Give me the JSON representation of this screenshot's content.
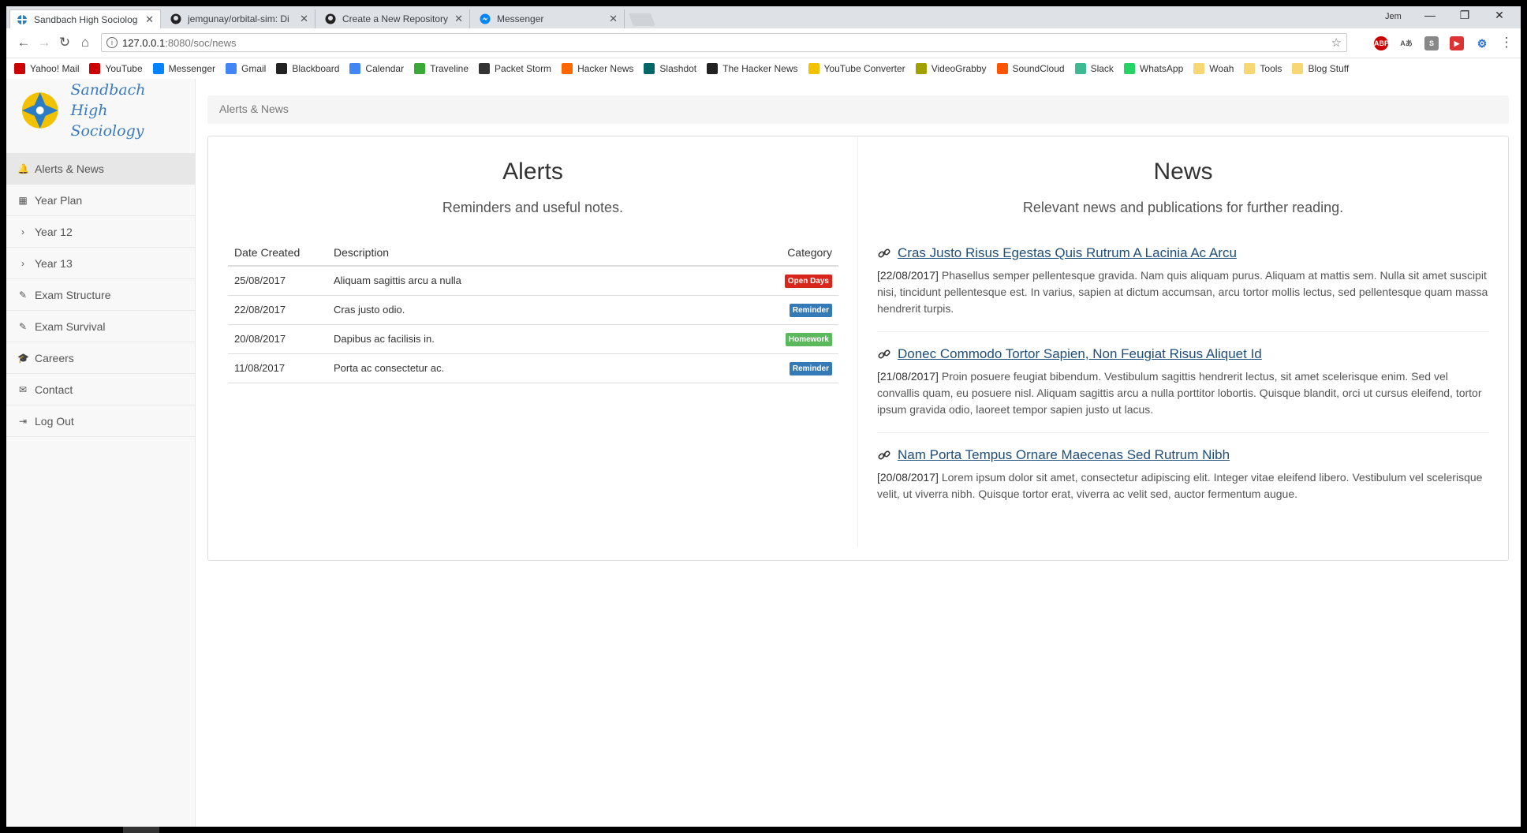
{
  "browser": {
    "tabs": [
      {
        "title": "Sandbach High Sociolog",
        "active": true,
        "icon": "site-logo-icon"
      },
      {
        "title": "jemgunay/orbital-sim: Di",
        "active": false,
        "icon": "github-icon"
      },
      {
        "title": "Create a New Repository",
        "active": false,
        "icon": "github-icon"
      },
      {
        "title": "Messenger",
        "active": false,
        "icon": "messenger-icon"
      }
    ],
    "user": "Jem",
    "url_host": "127.0.0.1",
    "url_path": ":8080/soc/news",
    "bookmarks": [
      {
        "label": "Yahoo! Mail",
        "color": "#cc0000",
        "icon": "youtube-red-icon"
      },
      {
        "label": "YouTube",
        "color": "#cc0000",
        "icon": "youtube-icon"
      },
      {
        "label": "Messenger",
        "color": "#0084ff",
        "icon": "messenger-icon"
      },
      {
        "label": "Gmail",
        "color": "#4285f4",
        "icon": "google-icon"
      },
      {
        "label": "Blackboard",
        "color": "#222222",
        "icon": "blackboard-icon"
      },
      {
        "label": "Calendar",
        "color": "#4285f4",
        "icon": "calendar-icon"
      },
      {
        "label": "Traveline",
        "color": "#3aa935",
        "icon": "traveline-icon"
      },
      {
        "label": "Packet Storm",
        "color": "#333333",
        "icon": "packetstorm-icon"
      },
      {
        "label": "Hacker News",
        "color": "#ff6600",
        "icon": "hackernews-icon"
      },
      {
        "label": "Slashdot",
        "color": "#006666",
        "icon": "slashdot-icon"
      },
      {
        "label": "The Hacker News",
        "color": "#222222",
        "icon": "thehackernews-icon"
      },
      {
        "label": "YouTube Converter",
        "color": "#f2c200",
        "icon": "converter-icon"
      },
      {
        "label": "VideoGrabby",
        "color": "#a0a000",
        "icon": "videograbby-icon"
      },
      {
        "label": "SoundCloud",
        "color": "#ff5500",
        "icon": "soundcloud-icon"
      },
      {
        "label": "Slack",
        "color": "#3eb991",
        "icon": "slack-icon"
      },
      {
        "label": "WhatsApp",
        "color": "#25d366",
        "icon": "whatsapp-icon"
      },
      {
        "label": "Woah",
        "color": "#f7d774",
        "icon": "folder-icon"
      },
      {
        "label": "Tools",
        "color": "#f7d774",
        "icon": "folder-icon"
      },
      {
        "label": "Blog Stuff",
        "color": "#f7d774",
        "icon": "folder-icon"
      }
    ]
  },
  "site": {
    "title_line1": "Sandbach High",
    "title_line2": "Sociology",
    "nav": [
      {
        "label": "Alerts & News",
        "icon": "bell-icon",
        "glyph": "🔔",
        "active": true
      },
      {
        "label": "Year Plan",
        "icon": "calendar-icon",
        "glyph": "▦",
        "active": false
      },
      {
        "label": "Year 12",
        "icon": "chevron-right-icon",
        "glyph": "›",
        "active": false
      },
      {
        "label": "Year 13",
        "icon": "chevron-right-icon",
        "glyph": "›",
        "active": false
      },
      {
        "label": "Exam Structure",
        "icon": "pencil-icon",
        "glyph": "✎",
        "active": false
      },
      {
        "label": "Exam Survival",
        "icon": "pencil-icon",
        "glyph": "✎",
        "active": false
      },
      {
        "label": "Careers",
        "icon": "graduation-cap-icon",
        "glyph": "🎓",
        "active": false
      },
      {
        "label": "Contact",
        "icon": "envelope-icon",
        "glyph": "✉",
        "active": false
      },
      {
        "label": "Log Out",
        "icon": "logout-icon",
        "glyph": "⇥",
        "active": false
      }
    ]
  },
  "breadcrumb": "Alerts & News",
  "alerts": {
    "title": "Alerts",
    "subtitle": "Reminders and useful notes.",
    "columns": [
      "Date Created",
      "Description",
      "Category"
    ],
    "rows": [
      {
        "date": "25/08/2017",
        "description": "Aliquam sagittis arcu a nulla",
        "category": "Open Days",
        "color": "#d9261c"
      },
      {
        "date": "22/08/2017",
        "description": "Cras justo odio.",
        "category": "Reminder",
        "color": "#337ab7"
      },
      {
        "date": "20/08/2017",
        "description": "Dapibus ac facilisis in.",
        "category": "Homework",
        "color": "#5cb85c"
      },
      {
        "date": "11/08/2017",
        "description": "Porta ac consectetur ac.",
        "category": "Reminder",
        "color": "#337ab7"
      }
    ]
  },
  "news": {
    "title": "News",
    "subtitle": "Relevant news and publications for further reading.",
    "items": [
      {
        "title": "Cras Justo Risus Egestas Quis Rutrum A Lacinia Ac Arcu",
        "date": "[22/08/2017]",
        "body": "Phasellus semper pellentesque gravida. Nam quis aliquam purus. Aliquam at mattis sem. Nulla sit amet suscipit nisi, tincidunt pellentesque est. In varius, sapien at dictum accumsan, arcu tortor mollis lectus, sed pellentesque quam massa hendrerit turpis."
      },
      {
        "title": "Donec Commodo Tortor Sapien, Non Feugiat Risus Aliquet Id",
        "date": "[21/08/2017]",
        "body": "Proin posuere feugiat bibendum. Vestibulum sagittis hendrerit lectus, sit amet scelerisque enim. Sed vel convallis quam, eu posuere nisl. Aliquam sagittis arcu a nulla porttitor lobortis. Quisque blandit, orci ut cursus eleifend, tortor ipsum gravida odio, laoreet tempor sapien justo ut lacus."
      },
      {
        "title": "Nam Porta Tempus Ornare Maecenas Sed Rutrum Nibh",
        "date": "[20/08/2017]",
        "body": "Lorem ipsum dolor sit amet, consectetur adipiscing elit. Integer vitae eleifend libero. Vestibulum vel scelerisque velit, ut viverra nibh. Quisque tortor erat, viverra ac velit sed, auctor fermentum augue."
      }
    ]
  }
}
